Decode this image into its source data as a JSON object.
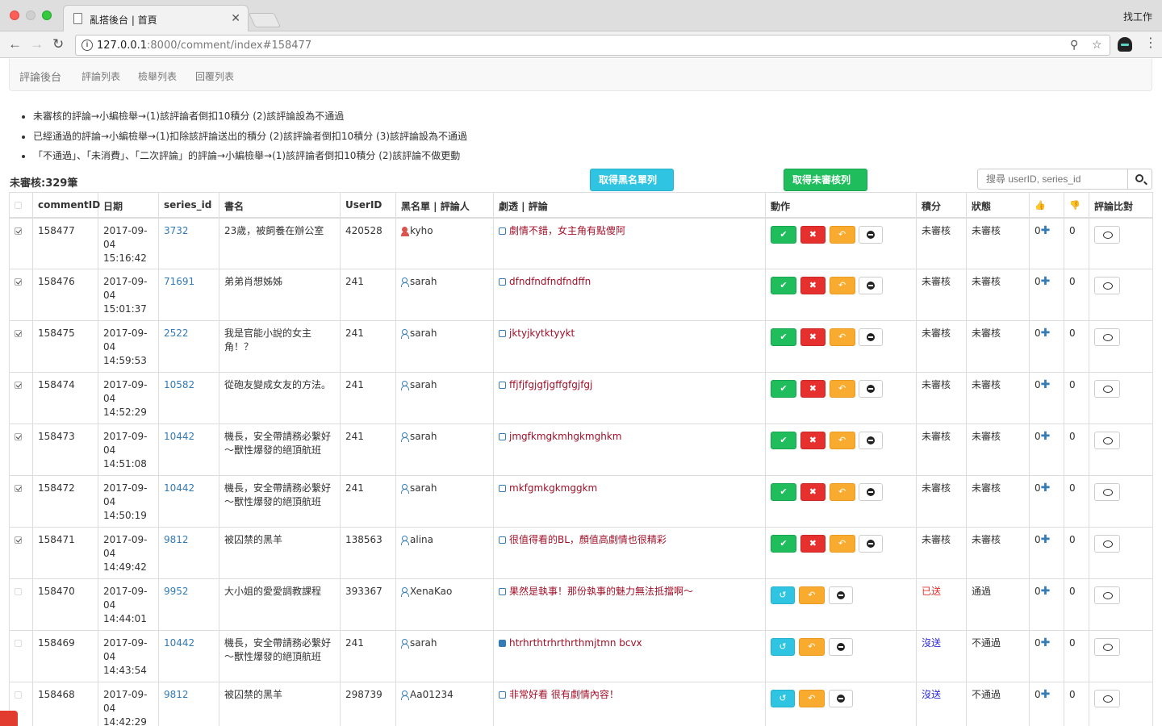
{
  "browser": {
    "tab_title": "亂搭後台 | 首頁",
    "tab_close": "✕",
    "profile_name": "找工作",
    "url_host": "127.0.0.1",
    "url_path": ":8000/comment/index#158477",
    "back_icon": "←",
    "forward_icon": "→",
    "reload_icon": "↻",
    "zoom_icon": "⚲",
    "star_icon": "☆",
    "menu_icon": "⋮",
    "info_icon": "i"
  },
  "navbar": {
    "brand": "評論後台",
    "links": [
      "評論列表",
      "檢舉列表",
      "回覆列表"
    ]
  },
  "rules": [
    "未審核的評論→小編檢舉→(1)該評論者倒扣10積分 (2)該評論設為不通過",
    "已經通過的評論→小編檢舉→(1)扣除該評論送出的積分 (2)該評論者倒扣10積分 (3)該評論設為不通過",
    "「不通過」、「未消費」、「二次評論」的評論→小編檢舉→(1)該評論者倒扣10積分 (2)該評論不做更動"
  ],
  "pending_count": "未審核:329筆",
  "buttons": {
    "blacklist": "取得黑名單列表",
    "unreviewed": "取得未審核列表"
  },
  "search": {
    "placeholder": "搜尋 userID, series_id"
  },
  "table": {
    "headers": [
      "commentID",
      "日期",
      "series_id",
      "書名",
      "UserID",
      "黑名單 | 評論人",
      "劇透 | 評論",
      "動作",
      "積分",
      "狀態",
      "評論比對"
    ],
    "rows": [
      {
        "id": "158477",
        "date1": "2017-09-",
        "date2": "04",
        "time": "15:16:42",
        "series": "3732",
        "book": "23歲，被飼養在辦公室",
        "user": "420528",
        "name": "kyho",
        "comment": "劇情不錯，女主角有點傻阿",
        "points": "未審核",
        "status": "未審核",
        "likes": "0",
        "dislikes": "0"
      },
      {
        "id": "158476",
        "date1": "2017-09-",
        "date2": "04",
        "time": "15:01:37",
        "series": "71691",
        "book": "弟弟肖想姊姊",
        "user": "241",
        "name": "sarah",
        "comment": "dfndfndfndfndffn",
        "points": "未審核",
        "status": "未審核",
        "likes": "0",
        "dislikes": "0"
      },
      {
        "id": "158475",
        "date1": "2017-09-",
        "date2": "04",
        "time": "14:59:53",
        "series": "2522",
        "book": "我是官能小說的女主角！？",
        "user": "241",
        "name": "sarah",
        "comment": "jktyjkytktyykt",
        "points": "未審核",
        "status": "未審核",
        "likes": "0",
        "dislikes": "0"
      },
      {
        "id": "158474",
        "date1": "2017-09-",
        "date2": "04",
        "time": "14:52:29",
        "series": "10582",
        "book": "從砲友變成女友的方法。",
        "user": "241",
        "name": "sarah",
        "comment": "ffjfjfgjgfjgffgfgjfgj",
        "points": "未審核",
        "status": "未審核",
        "likes": "0",
        "dislikes": "0"
      },
      {
        "id": "158473",
        "date1": "2017-09-",
        "date2": "04",
        "time": "14:51:08",
        "series": "10442",
        "book": "機長，安全帶請務必繫好～獸性爆發的絕頂航班",
        "user": "241",
        "name": "sarah",
        "comment": "jmgfkmgkmhgkmghkm",
        "points": "未審核",
        "status": "未審核",
        "likes": "0",
        "dislikes": "0"
      },
      {
        "id": "158472",
        "date1": "2017-09-",
        "date2": "04",
        "time": "14:50:19",
        "series": "10442",
        "book": "機長，安全帶請務必繫好～獸性爆發的絕頂航班",
        "user": "241",
        "name": "sarah",
        "comment": "mkfgmkgkmggkm",
        "points": "未審核",
        "status": "未審核",
        "likes": "0",
        "dislikes": "0"
      },
      {
        "id": "158471",
        "date1": "2017-09-",
        "date2": "04",
        "time": "14:49:42",
        "series": "9812",
        "book": "被囚禁的黑羊",
        "user": "138563",
        "name": "alina",
        "comment": "很值得看的BL，顏值高劇情也很精彩",
        "points": "未審核",
        "status": "未審核",
        "likes": "0",
        "dislikes": "0"
      },
      {
        "id": "158470",
        "date1": "2017-09-",
        "date2": "04",
        "time": "14:44:01",
        "series": "9952",
        "book": "大小姐的愛愛調教課程",
        "user": "393367",
        "name": "XenaKao",
        "comment": "果然是執事！那份執事的魅力無法抵擋啊～",
        "points": "已送",
        "status": "通過",
        "likes": "0",
        "dislikes": "0"
      },
      {
        "id": "158469",
        "date1": "2017-09-",
        "date2": "04",
        "time": "14:43:54",
        "series": "10442",
        "book": "機長，安全帶請務必繫好～獸性爆發的絕頂航班",
        "user": "241",
        "name": "sarah",
        "comment": "htrhrthtrhrthrthmjtmn bcvx",
        "points": "沒送",
        "status": "不通過",
        "likes": "0",
        "dislikes": "0"
      },
      {
        "id": "158468",
        "date1": "2017-09-",
        "date2": "04",
        "time": "14:42:29",
        "series": "9812",
        "book": "被囚禁的黑羊",
        "user": "298739",
        "name": "Aa01234",
        "comment": "非常好看 很有劇情內容！",
        "points": "沒送",
        "status": "不通過",
        "likes": "0",
        "dislikes": "0"
      }
    ]
  },
  "icons": {
    "approve": "✔",
    "reject": "✖",
    "reply": "↶",
    "reset": "↺",
    "plus": "✚",
    "thumb_up": "👍",
    "thumb_down": "👎"
  },
  "colors": {
    "success": "#1fbd5c",
    "danger": "#e5302e",
    "warning": "#f8ab2f",
    "info": "#2fc4e2",
    "link": "#337ab7",
    "comment": "#a10f28"
  }
}
